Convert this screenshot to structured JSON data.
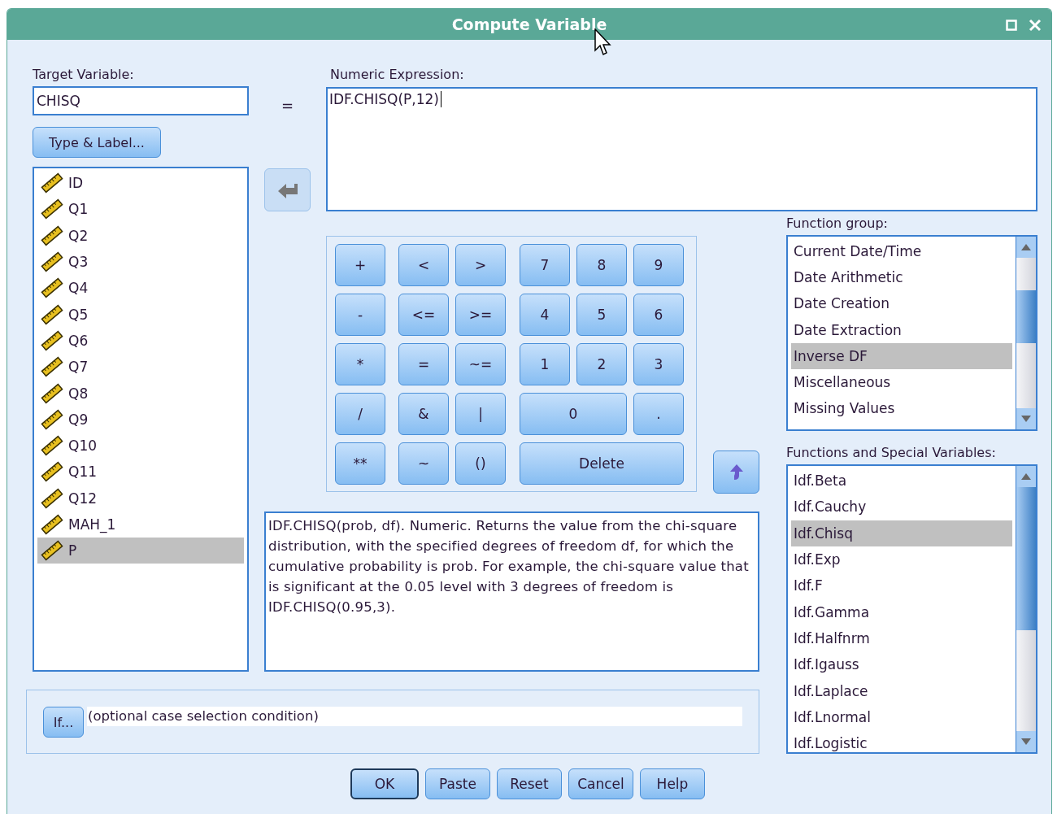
{
  "window": {
    "title": "Compute Variable"
  },
  "target": {
    "label": "Target Variable:",
    "value": "CHISQ",
    "equals": "=",
    "type_button": "Type & Label..."
  },
  "variables": [
    {
      "name": "ID",
      "selected": false
    },
    {
      "name": "Q1",
      "selected": false
    },
    {
      "name": "Q2",
      "selected": false
    },
    {
      "name": "Q3",
      "selected": false
    },
    {
      "name": "Q4",
      "selected": false
    },
    {
      "name": "Q5",
      "selected": false
    },
    {
      "name": "Q6",
      "selected": false
    },
    {
      "name": "Q7",
      "selected": false
    },
    {
      "name": "Q8",
      "selected": false
    },
    {
      "name": "Q9",
      "selected": false
    },
    {
      "name": "Q10",
      "selected": false
    },
    {
      "name": "Q11",
      "selected": false
    },
    {
      "name": "Q12",
      "selected": false
    },
    {
      "name": "MAH_1",
      "selected": false
    },
    {
      "name": "P",
      "selected": true
    }
  ],
  "expression": {
    "label": "Numeric Expression:",
    "value": "IDF.CHISQ(P,12)"
  },
  "keypad": [
    [
      {
        "label": "+",
        "wide": false
      },
      {
        "label": "<",
        "wide": false
      },
      {
        "label": ">",
        "wide": false
      },
      {
        "label": "7",
        "wide": false
      },
      {
        "label": "8",
        "wide": false
      },
      {
        "label": "9",
        "wide": false
      }
    ],
    [
      {
        "label": "-",
        "wide": false
      },
      {
        "label": "<=",
        "wide": false
      },
      {
        "label": ">=",
        "wide": false
      },
      {
        "label": "4",
        "wide": false
      },
      {
        "label": "5",
        "wide": false
      },
      {
        "label": "6",
        "wide": false
      }
    ],
    [
      {
        "label": "*",
        "wide": false
      },
      {
        "label": "=",
        "wide": false
      },
      {
        "label": "~=",
        "wide": false
      },
      {
        "label": "1",
        "wide": false
      },
      {
        "label": "2",
        "wide": false
      },
      {
        "label": "3",
        "wide": false
      }
    ],
    [
      {
        "label": "/",
        "wide": false
      },
      {
        "label": "&",
        "wide": false
      },
      {
        "label": "|",
        "wide": false
      },
      {
        "label": "0",
        "wide": true
      },
      {
        "label": ".",
        "wide": false
      }
    ],
    [
      {
        "label": "**",
        "wide": false
      },
      {
        "label": "~",
        "wide": false
      },
      {
        "label": "()",
        "wide": false
      },
      {
        "label": "Delete",
        "wide": true
      }
    ]
  ],
  "description": "IDF.CHISQ(prob, df). Numeric. Returns the value from the chi-square distribution, with the specified degrees of freedom df, for which the cumulative probability is prob. For example, the chi-square value that is significant at the 0.05 level with 3 degrees of freedom is IDF.CHISQ(0.95,3).",
  "function_group": {
    "label": "Function group:",
    "items": [
      {
        "name": "Current Date/Time",
        "selected": false
      },
      {
        "name": "Date Arithmetic",
        "selected": false
      },
      {
        "name": "Date Creation",
        "selected": false
      },
      {
        "name": "Date Extraction",
        "selected": false
      },
      {
        "name": "Inverse DF",
        "selected": true
      },
      {
        "name": "Miscellaneous",
        "selected": false
      },
      {
        "name": "Missing Values",
        "selected": false
      }
    ]
  },
  "functions": {
    "label": "Functions and Special Variables:",
    "items": [
      {
        "name": "Idf.Beta",
        "selected": false
      },
      {
        "name": "Idf.Cauchy",
        "selected": false
      },
      {
        "name": "Idf.Chisq",
        "selected": true
      },
      {
        "name": "Idf.Exp",
        "selected": false
      },
      {
        "name": "Idf.F",
        "selected": false
      },
      {
        "name": "Idf.Gamma",
        "selected": false
      },
      {
        "name": "Idf.Halfnrm",
        "selected": false
      },
      {
        "name": "Idf.Igauss",
        "selected": false
      },
      {
        "name": "Idf.Laplace",
        "selected": false
      },
      {
        "name": "Idf.Lnormal",
        "selected": false
      },
      {
        "name": "Idf.Logistic",
        "selected": false
      }
    ]
  },
  "condition": {
    "button": "If...",
    "value": "(optional case selection condition)"
  },
  "buttons": [
    {
      "label": "OK",
      "default": true
    },
    {
      "label": "Paste",
      "default": false
    },
    {
      "label": "Reset",
      "default": false
    },
    {
      "label": "Cancel",
      "default": false
    },
    {
      "label": "Help",
      "default": false
    }
  ]
}
